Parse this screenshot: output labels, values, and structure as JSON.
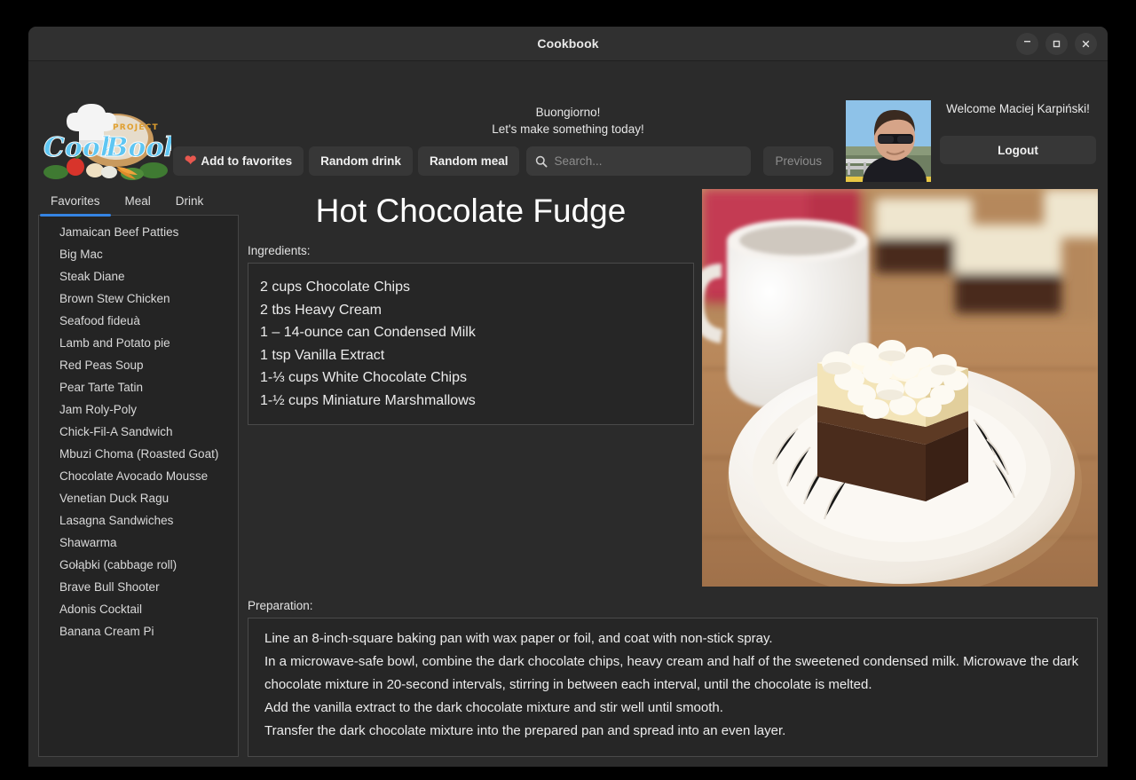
{
  "window": {
    "title": "Cookbook",
    "controls": {
      "minimize": "minimize-icon",
      "maximize": "maximize-icon",
      "close": "close-icon"
    }
  },
  "header": {
    "logo": {
      "top_text": "PROJECT",
      "word1": "Cook",
      "word2": "Book"
    },
    "greeting_line1": "Buongiorno!",
    "greeting_line2": "Let's make something today!",
    "toolbar": {
      "add_to_favorites": "Add to favorites",
      "random_drink": "Random drink",
      "random_meal": "Random meal",
      "previous": "Previous"
    },
    "search": {
      "value": "",
      "placeholder": "Search..."
    },
    "user": {
      "welcome": "Welcome Maciej Karpiński!",
      "logout": "Logout"
    }
  },
  "sidebar": {
    "tabs": [
      {
        "label": "Favorites",
        "active": true
      },
      {
        "label": "Meal",
        "active": false
      },
      {
        "label": "Drink",
        "active": false
      }
    ],
    "items": [
      "Jamaican Beef Patties",
      "Big Mac",
      "Steak Diane",
      "Brown Stew Chicken",
      "Seafood fideuà",
      "Lamb and Potato pie",
      "Red Peas Soup",
      "Pear Tarte Tatin",
      "Jam Roly-Poly",
      "Chick-Fil-A Sandwich",
      "Mbuzi Choma (Roasted Goat)",
      "Chocolate Avocado Mousse",
      "Venetian Duck Ragu",
      "Lasagna Sandwiches",
      "Shawarma",
      "Gołąbki (cabbage roll)",
      "Brave Bull Shooter",
      "Adonis Cocktail",
      "Banana Cream Pi"
    ]
  },
  "recipe": {
    "title": "Hot Chocolate Fudge",
    "ingredients_label": "Ingredients:",
    "ingredients": [
      "2 cups Chocolate Chips",
      "2 tbs Heavy Cream",
      "1 – 14-ounce can Condensed Milk",
      "1 tsp Vanilla Extract",
      "1-⅓ cups White Chocolate Chips",
      "1-½ cups Miniature Marshmallows"
    ],
    "preparation_label": "Preparation:",
    "preparation": [
      "Line an 8-inch-square baking pan with wax paper or foil, and coat with non-stick spray.",
      "In a microwave-safe bowl, combine the dark chocolate chips, heavy cream and half of the sweetened condensed milk. Microwave the dark chocolate mixture in 20-second intervals, stirring in between each interval, until the chocolate is melted.",
      "Add the vanilla extract to the dark chocolate mixture and stir well until smooth.",
      "Transfer the dark chocolate mixture into the prepared pan and spread into an even layer."
    ],
    "photo_alt": "hot-chocolate-fudge-square-on-white-plate-with-mug"
  },
  "colors": {
    "accent": "#3584e4",
    "heart": "#e8584f",
    "window_bg": "#2b2b2b",
    "panel_bg": "#262626",
    "titlebar_bg": "#303030",
    "border": "#4a4a4a"
  }
}
